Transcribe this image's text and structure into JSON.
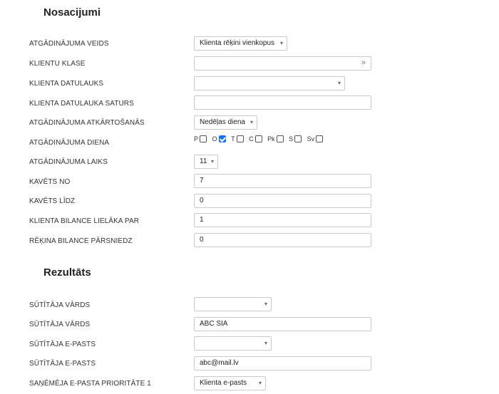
{
  "sections": {
    "reminders_title": "Nosacijumi",
    "results_title": "Rezultāts"
  },
  "reminders": {
    "type": {
      "label": "ATGĀDINĀJUMA VEIDS",
      "value": "Klienta rēķini vienkopus"
    },
    "client_class": {
      "label": "KLIENTU KLASE",
      "value": ""
    },
    "client_datafield": {
      "label": "KLIENTA DATULAUKS",
      "value": ""
    },
    "client_datafield_content": {
      "label": "KLIENTA DATULAUKA SATURS",
      "value": ""
    },
    "recurrence": {
      "label": "ATGĀDINĀJUMA ATKĀRTOŠANĀS",
      "value": "Nedēļas diena"
    },
    "day": {
      "label": "ATGĀDINĀJUMA DIENA",
      "options": [
        {
          "label": "P",
          "checked": false
        },
        {
          "label": "O",
          "checked": true
        },
        {
          "label": "T",
          "checked": false
        },
        {
          "label": "C",
          "checked": false
        },
        {
          "label": "Pk",
          "checked": false
        },
        {
          "label": "S",
          "checked": false
        },
        {
          "label": "Sv",
          "checked": false
        }
      ]
    },
    "time": {
      "label": "ATGĀDINĀJUMA LAIKS",
      "value": "11"
    },
    "overdue_from": {
      "label": "KAVĒTS NO",
      "value": "7"
    },
    "overdue_to": {
      "label": "KAVĒTS LĪDZ",
      "value": "0"
    },
    "client_balance": {
      "label": "KLIENTA BILANCE LIELĀKA PAR",
      "value": "1"
    },
    "invoice_balance": {
      "label": "RĒĶINA BILANCE PĀRSNIEDZ",
      "value": "0"
    }
  },
  "results": {
    "sender_name_select": {
      "label": "SŪTĪTĀJA VĀRDS",
      "value": ""
    },
    "sender_name": {
      "label": "SŪTĪTĀJA VĀRDS",
      "value": "ABC SIA"
    },
    "sender_email_select": {
      "label": "SŪTĪTĀJA E-PASTS",
      "value": ""
    },
    "sender_email": {
      "label": "SŪTĪTĀJA E-PASTS",
      "value": "abc@mail.lv"
    },
    "recipient_priority": {
      "label": "SAŅĒMĒJA E-PASTA PRIORITĀTE 1",
      "value": "Klienta e-pasts"
    }
  },
  "icons": {
    "dropdown": "▾",
    "more": "»"
  }
}
